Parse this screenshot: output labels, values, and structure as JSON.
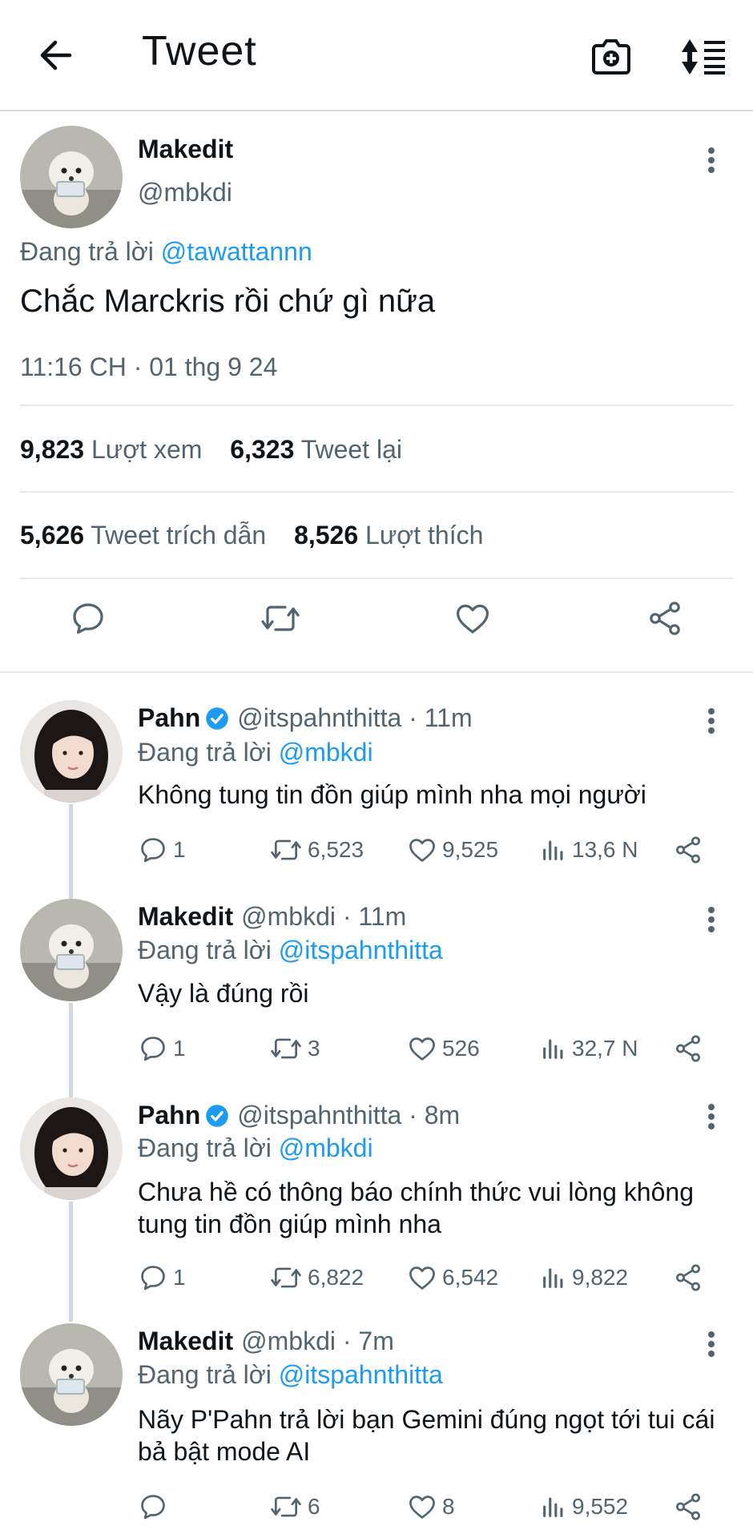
{
  "header": {
    "title": "Tweet",
    "back_icon": "arrow-left-icon",
    "camera_icon": "camera-plus-icon",
    "sort_icon": "sort-list-icon"
  },
  "main_tweet": {
    "name": "Makedit",
    "handle": "@mbkdi",
    "reply_prefix": "Đang trả lời",
    "reply_to": "@tawattannn",
    "text": "Chắc Marckris rồi chứ gì nữa",
    "time": "11:16 CH · 01 thg 9 24",
    "views_count": "9,823",
    "views_label": "Lượt xem",
    "retweets_count": "6,323",
    "retweets_label": "Tweet lại",
    "quotes_count": "5,626",
    "quotes_label": "Tweet trích dẫn",
    "likes_count": "8,526",
    "likes_label": "Lượt thích"
  },
  "replies": [
    {
      "name": "Pahn",
      "verified": true,
      "handle": "@itspahnthitta · 11m",
      "reply_prefix": "Đang trả lời",
      "reply_to": "@mbkdi",
      "text": "Không tung tin đồn giúp mình nha mọi người",
      "replies": "1",
      "retweets": "6,523",
      "likes": "9,525",
      "views": "13,6 N"
    },
    {
      "name": "Makedit",
      "verified": false,
      "handle": "@mbkdi · 11m",
      "reply_prefix": "Đang trả lời",
      "reply_to": "@itspahnthitta",
      "text": "Vậy là đúng rồi",
      "replies": "1",
      "retweets": "3",
      "likes": "526",
      "views": "32,7 N"
    },
    {
      "name": "Pahn",
      "verified": true,
      "handle": "@itspahnthitta · 8m",
      "reply_prefix": "Đang trả lời",
      "reply_to": "@mbkdi",
      "text": "Chưa hề có thông báo chính thức vui lòng không tung tin đồn giúp mình nha",
      "replies": "1",
      "retweets": "6,822",
      "likes": "6,542",
      "views": "9,822"
    },
    {
      "name": "Makedit",
      "verified": false,
      "handle": "@mbkdi · 7m",
      "reply_prefix": "Đang trả lời",
      "reply_to": "@itspahnthitta",
      "text": "Nãy P'Pahn trả lời bạn Gemini đúng ngọt tới tui cái bả bật mode AI",
      "replies": "",
      "retweets": "6",
      "likes": "8",
      "views": "9,552"
    }
  ],
  "colors": {
    "accent": "#1d9bf0",
    "secondary_text": "#536471",
    "primary_text": "#0f1419",
    "divider": "#e6e8ea"
  }
}
